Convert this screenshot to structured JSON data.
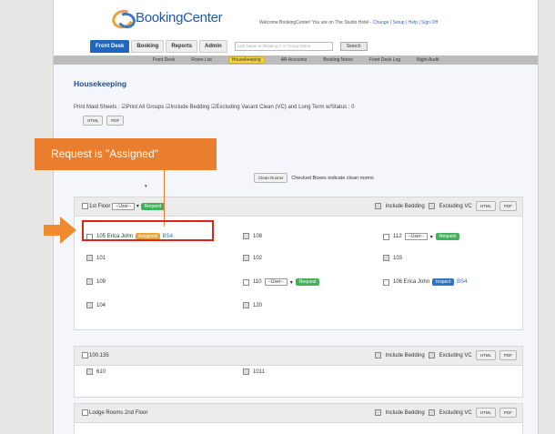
{
  "header": {
    "logo_text": "BookingCenter",
    "welcome_text": "Welcome BookingCenter! You are on The Studio Hotel -",
    "links": [
      "Change",
      "Setup",
      "Help",
      "Sign Off"
    ]
  },
  "nav": {
    "tabs": [
      "Front Desk",
      "Booking",
      "Reports",
      "Admin"
    ],
    "search_placeholder": "Last Name or Booking # or Group Name",
    "go_label": "Search"
  },
  "subnav": {
    "items": [
      "Front Desk",
      "Room List",
      "Housekeeping",
      "AR Accounts",
      "Booking Notes",
      "Front Desk Log",
      "Night Audit"
    ],
    "active": "Housekeeping"
  },
  "page": {
    "title": "Housekeeping",
    "maid_sheets_text": "Print Maid Sheets : ☑Print All Groups ☑Include Bedding ☑Excluding Vacant Clean (VC) and Long Term w/Status : 0",
    "html_label": "HTML",
    "pdf_label": "PDF",
    "clean_rooms_label": "Clean Rooms",
    "clean_note": "Checked Boxes indicate clean rooms"
  },
  "callout": {
    "text": "Request is \"Assigned\""
  },
  "sections": [
    {
      "name": "1st Floor",
      "user_select": "--User--",
      "request_label": "Request",
      "include_bedding": "Include Bedding",
      "excluding_vc": "Excluding VC",
      "rooms": {
        "r105": "105 Erica John",
        "assigned": "Assigned",
        "r105_link": "BS4",
        "r108": "108",
        "r112": "112",
        "r112_user": "--User--",
        "r101": "101",
        "r102": "102",
        "r103": "103",
        "r109": "109",
        "r110": "110",
        "r110_user": "--User--",
        "r106": "106 Erica John",
        "inspect": "Inspect",
        "r106_link": "BS4",
        "r104": "104",
        "r120": "120"
      }
    },
    {
      "name": "100.135",
      "rooms": {
        "r610": "610",
        "r1011": "1011"
      }
    },
    {
      "name": "Lodge Rooms 2nd Floor"
    }
  ]
}
